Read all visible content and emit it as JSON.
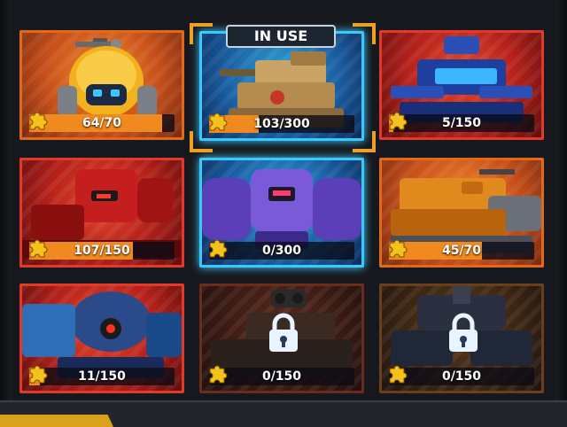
{
  "in_use_label": "IN USE",
  "colors": {
    "progress_fill": "#f08a1e",
    "in_use_glow": "#39c9ff",
    "card_border": "#e06a1a"
  },
  "cards": [
    {
      "name": "yellow-dome-bot",
      "progress": "64/70",
      "fraction": 0.914,
      "theme": "orange",
      "locked": false,
      "in_use": false
    },
    {
      "name": "desert-tank-mech",
      "progress": "103/300",
      "fraction": 0.343,
      "theme": "orange",
      "locked": false,
      "in_use": true
    },
    {
      "name": "blue-spider-mech",
      "progress": "5/150",
      "fraction": 0.033,
      "theme": "red",
      "locked": false,
      "in_use": false
    },
    {
      "name": "red-armor-mech",
      "progress": "107/150",
      "fraction": 0.713,
      "theme": "red",
      "locked": false,
      "in_use": false
    },
    {
      "name": "purple-brute-mech",
      "progress": "0/300",
      "fraction": 0.0,
      "theme": "blue",
      "locked": false,
      "in_use": false
    },
    {
      "name": "orange-tank-mech",
      "progress": "45/70",
      "fraction": 0.643,
      "theme": "orange",
      "locked": false,
      "in_use": false
    },
    {
      "name": "blue-laser-mech",
      "progress": "11/150",
      "fraction": 0.073,
      "theme": "red",
      "locked": false,
      "in_use": false
    },
    {
      "name": "locked-mech-1",
      "progress": "0/150",
      "fraction": 0.0,
      "theme": "locked-red",
      "locked": true,
      "in_use": false
    },
    {
      "name": "locked-mech-2",
      "progress": "0/150",
      "fraction": 0.0,
      "theme": "locked-orange",
      "locked": true,
      "in_use": false
    }
  ]
}
